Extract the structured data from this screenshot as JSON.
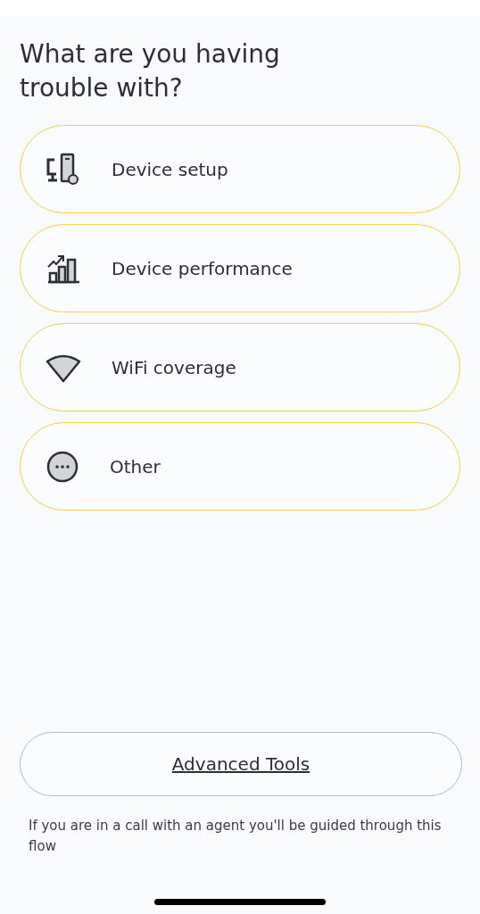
{
  "title": "What are you having trouble with?",
  "options": [
    {
      "kind": "devices",
      "label": "Device setup"
    },
    {
      "kind": "chart",
      "label": "Device performance"
    },
    {
      "kind": "wifi",
      "label": "WiFi coverage"
    },
    {
      "kind": "more",
      "label": "Other"
    }
  ],
  "advanced_button": "Advanced Tools",
  "note": "If you are in a call with an agent you'll be guided through this flow"
}
